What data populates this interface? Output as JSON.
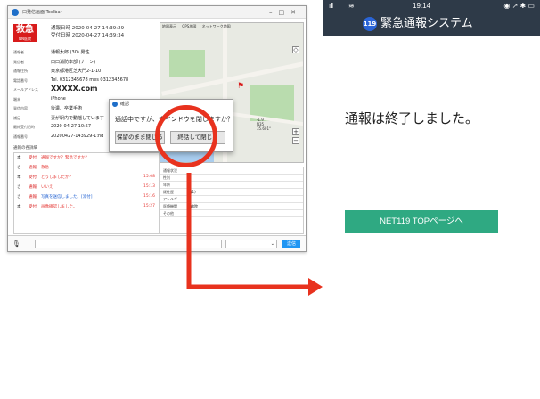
{
  "desktop": {
    "window_title": "口発信画面 Toolbar",
    "badge": {
      "label": "救急",
      "sub": "NN医院"
    },
    "datetimes": [
      "通報日時 2020-04-27 14:39:29",
      "受付日時 2020-04-27 14:39:34"
    ],
    "info_rows": [
      {
        "label": "通報者",
        "value": "通報太郎 (30) 男性",
        "big": false
      },
      {
        "label": "発信者",
        "value": "口口消防本部 (ナーン)",
        "big": false
      },
      {
        "label": "通報住所",
        "value": "東京都港区芝大門2-1-10",
        "big": false
      },
      {
        "label": "電話番号",
        "value": "Tel. 0312345678 mes 0312345678",
        "big": false
      },
      {
        "label": "メールアドレス",
        "value": "XXXXX.com",
        "big": true
      },
      {
        "label": "端末",
        "value": "iPhone",
        "big": false
      },
      {
        "label": "発信内容",
        "value": "後遺、卒業手術",
        "big": false
      },
      {
        "label": "補足",
        "value": "妻が駅内で動揺しています",
        "big": false
      },
      {
        "label": "最終受付日時",
        "value": "2020-04-27 10:57",
        "big": false
      },
      {
        "label": "通報番号",
        "value": "20200427-143929-1:hd",
        "big": false
      }
    ],
    "history_header": "通報の各詳細",
    "history": [
      {
        "who": "本",
        "tag": "受付",
        "msg": "通報ですか？緊急ですか？",
        "time": "",
        "blue": false
      },
      {
        "who": "さ",
        "tag": "通報",
        "msg": "救急",
        "time": "",
        "blue": false
      },
      {
        "who": "本",
        "tag": "受付",
        "msg": "どうしましたか？",
        "time": "15:08",
        "blue": false
      },
      {
        "who": "さ",
        "tag": "通報",
        "msg": "いいえ",
        "time": "15:13",
        "blue": false
      },
      {
        "who": "さ",
        "tag": "通報",
        "msg": "写真を送信しました。[添付]",
        "time": "15:16",
        "blue": true
      },
      {
        "who": "本",
        "tag": "受付",
        "msg": "画像確認しました。",
        "time": "15:27",
        "blue": false
      }
    ],
    "map": {
      "tabs": [
        "地図表示",
        "GPS地図",
        "ネットワーク地図"
      ],
      "coord_lines": [
        "-1.9",
        "N35",
        "35.601°"
      ]
    },
    "table_rows": [
      {
        "key": "通報状況",
        "value": ""
      },
      {
        "key": "性別",
        "value": ""
      },
      {
        "key": "年齢",
        "value": ""
      },
      {
        "key": "既往歴",
        "value": "(1)"
      },
      {
        "key": "アレルギー",
        "value": ""
      },
      {
        "key": "医療機関",
        "value": "病院"
      },
      {
        "key": "その他",
        "value": ""
      }
    ],
    "send_label": "送信",
    "dialog": {
      "title": "確認",
      "message": "通話中ですが、ウインドウを閉じますか？",
      "keep_label": "保留のまま閉じる",
      "end_label": "終話して閉じる"
    }
  },
  "phone": {
    "status": {
      "signal": "ııll",
      "time": "19:14",
      "icons": "◉ ↗ ✱ ▭"
    },
    "badge": "119",
    "title": "緊急通報システム",
    "ended_message": "通報は終了しました。",
    "button_label": "NET119 TOPページへ"
  },
  "colors": {
    "highlight": "#e8321e",
    "phone_nav": "#2e3a48",
    "phone_button": "#2fa982",
    "emergency_red": "#d81b1b"
  }
}
